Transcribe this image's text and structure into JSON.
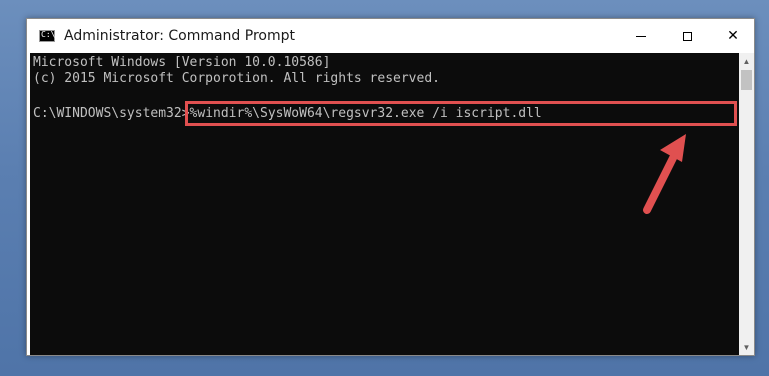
{
  "window": {
    "title": "Administrator: Command Prompt",
    "icon_text": "C:\\",
    "controls": {
      "minimize_icon": "minimize-icon",
      "maximize_icon": "maximize-icon",
      "close_icon": "close-icon",
      "close_glyph": "✕"
    }
  },
  "console": {
    "lines": [
      "Microsoft Windows [Version 10.0.10586]",
      "(c) 2015 Microsoft Corporotion. All rights reserved."
    ],
    "prompt": "C:\\WINDOWS\\system32>",
    "command": "%windir%\\SysWoW64\\regsvr32.exe /i iscript.dll"
  },
  "annotation": {
    "highlight_color": "#e05050",
    "arrow_color": "#e05050"
  },
  "scrollbar": {
    "up_glyph": "▲",
    "down_glyph": "▼"
  }
}
